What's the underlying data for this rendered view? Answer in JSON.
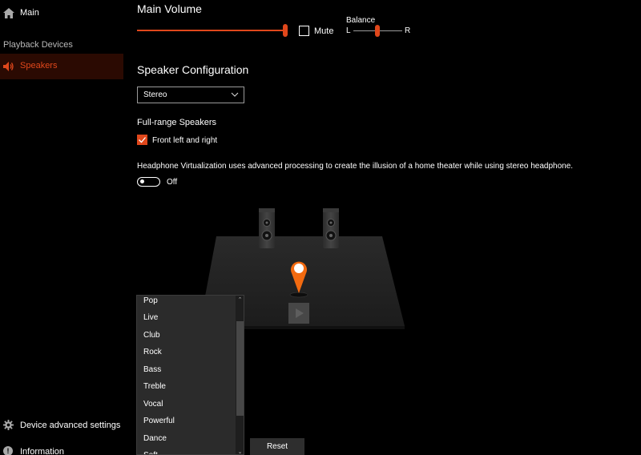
{
  "sidebar": {
    "main_label": "Main",
    "section_label": "Playback Devices",
    "speakers_label": "Speakers",
    "advanced_label": "Device advanced settings",
    "information_label": "Information"
  },
  "volume": {
    "title": "Main Volume",
    "level_percent": 100,
    "mute_label": "Mute",
    "muted": false,
    "balance_label": "Balance",
    "balance_left": "L",
    "balance_right": "R",
    "balance_position": 0.5
  },
  "speaker_config": {
    "title": "Speaker Configuration",
    "selected": "Stereo",
    "full_range_title": "Full-range Speakers",
    "front_label": "Front left and right",
    "front_checked": true,
    "hv_description": "Headphone Virtualization uses advanced processing to create the illusion of a home theater while using stereo headphone.",
    "hv_state": "Off"
  },
  "presets": {
    "items": [
      "Pop",
      "Live",
      "Club",
      "Rock",
      "Bass",
      "Treble",
      "Vocal",
      "Powerful",
      "Dance",
      "Soft"
    ]
  },
  "reset_label": "Reset",
  "colors": {
    "accent": "#e0471b",
    "pin": "#f26a10",
    "selected_bg": "#2b0a02"
  }
}
